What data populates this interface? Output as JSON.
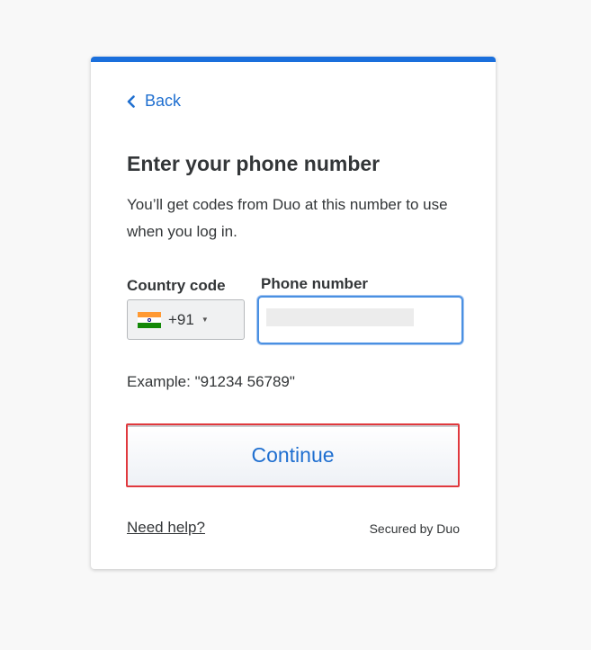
{
  "header": {
    "back_label": "Back"
  },
  "main": {
    "title": "Enter your phone number",
    "description": "You’ll get codes from Duo at this number to use when you log in.",
    "country_code_label": "Country code",
    "phone_number_label": "Phone number",
    "country": {
      "flag": "india-flag-icon",
      "dial_code": "+91"
    },
    "phone_input": {
      "value": ""
    },
    "example": "Example: \"91234 56789\"",
    "continue_label": "Continue"
  },
  "footer": {
    "help_label": "Need help?",
    "secured_label": "Secured by Duo"
  },
  "colors": {
    "accent": "#1a6fdc",
    "link": "#1f6fd0",
    "highlight_border": "#e0393e",
    "focus_border": "#4a90e2"
  }
}
